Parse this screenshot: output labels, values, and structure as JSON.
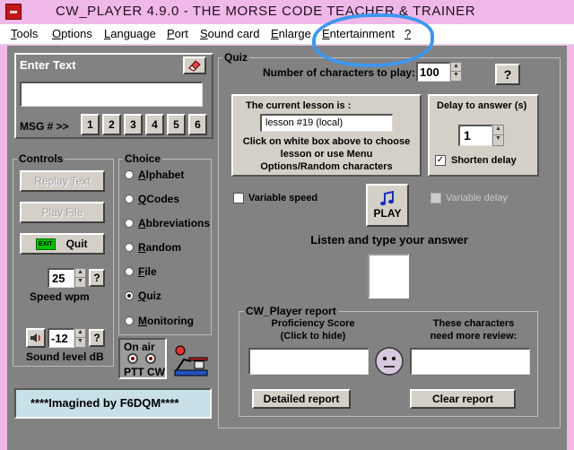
{
  "window": {
    "title": "CW_PLAYER 4.9.0 - THE  MORSE  CODE  TEACHER  &  TRAINER"
  },
  "menu": [
    {
      "first": "T",
      "rest": "ools"
    },
    {
      "first": "O",
      "rest": "ptions"
    },
    {
      "first": "L",
      "rest": "anguage"
    },
    {
      "first": "P",
      "rest": "ort"
    },
    {
      "first": "S",
      "rest": "ound card"
    },
    {
      "first": "E",
      "rest": "nlarge"
    },
    {
      "first": "E",
      "rest": "ntertainment"
    },
    {
      "first": "?",
      "rest": ""
    }
  ],
  "enter_text": {
    "title": "Enter Text",
    "value": "",
    "msg_label": "MSG # >>",
    "msg_buttons": [
      "1",
      "2",
      "3",
      "4",
      "5",
      "6"
    ]
  },
  "controls": {
    "title": "Controls",
    "replay": "Replay Text",
    "play_file": "Play File",
    "quit": "Quit",
    "exit_badge": "EXIT",
    "speed_value": "25",
    "speed_label": "Speed   wpm",
    "help": "?",
    "sound_value": "-12",
    "sound_label": "Sound level dB"
  },
  "choice": {
    "title": "Choice",
    "options": [
      {
        "u": "A",
        "rest": "lphabet",
        "selected": false
      },
      {
        "u": "Q",
        "rest": " Codes",
        "selected": false
      },
      {
        "u": "A",
        "rest": "bbreviations",
        "selected": false
      },
      {
        "u": "R",
        "rest": "andom",
        "selected": false
      },
      {
        "u": "F",
        "rest": "ile",
        "selected": false
      },
      {
        "u": "Q",
        "rest": "uiz",
        "selected": true
      },
      {
        "u": "M",
        "rest": "onitoring",
        "selected": false
      }
    ]
  },
  "on_air": {
    "title": "On air",
    "ptt": "PTT CW"
  },
  "credit": "****Imagined by F6DQM****",
  "quiz": {
    "title": "Quiz",
    "num_chars_label": "Number of characters to play:",
    "num_chars_value": "100",
    "help": "?",
    "lesson_title": "The current lesson is :",
    "lesson_value": "lesson #19 (local)",
    "lesson_hint_1": "Click on white box above to choose",
    "lesson_hint_2": "lesson or use Menu",
    "lesson_hint_3": "Options/Random characters",
    "delay_title": "Delay to answer (s)",
    "delay_value": "1",
    "shorten_delay": "Shorten delay",
    "variable_speed": "Variable speed",
    "variable_delay": "Variable delay",
    "play": "PLAY",
    "listen": "Listen and type your answer",
    "report_title": "CW_Player report",
    "proficiency_1": "Proficiency Score",
    "proficiency_2": "(Click to hide)",
    "review_1": "These characters",
    "review_2": "need more review:",
    "detailed": "Detailed report",
    "clear": "Clear report"
  },
  "colors": {
    "window_frame": "#f0b8e8",
    "panel_bg": "#828282",
    "button_face": "#d4d0c8",
    "annotation": "#3d97f0",
    "credit_bg": "#c8e0e8"
  }
}
